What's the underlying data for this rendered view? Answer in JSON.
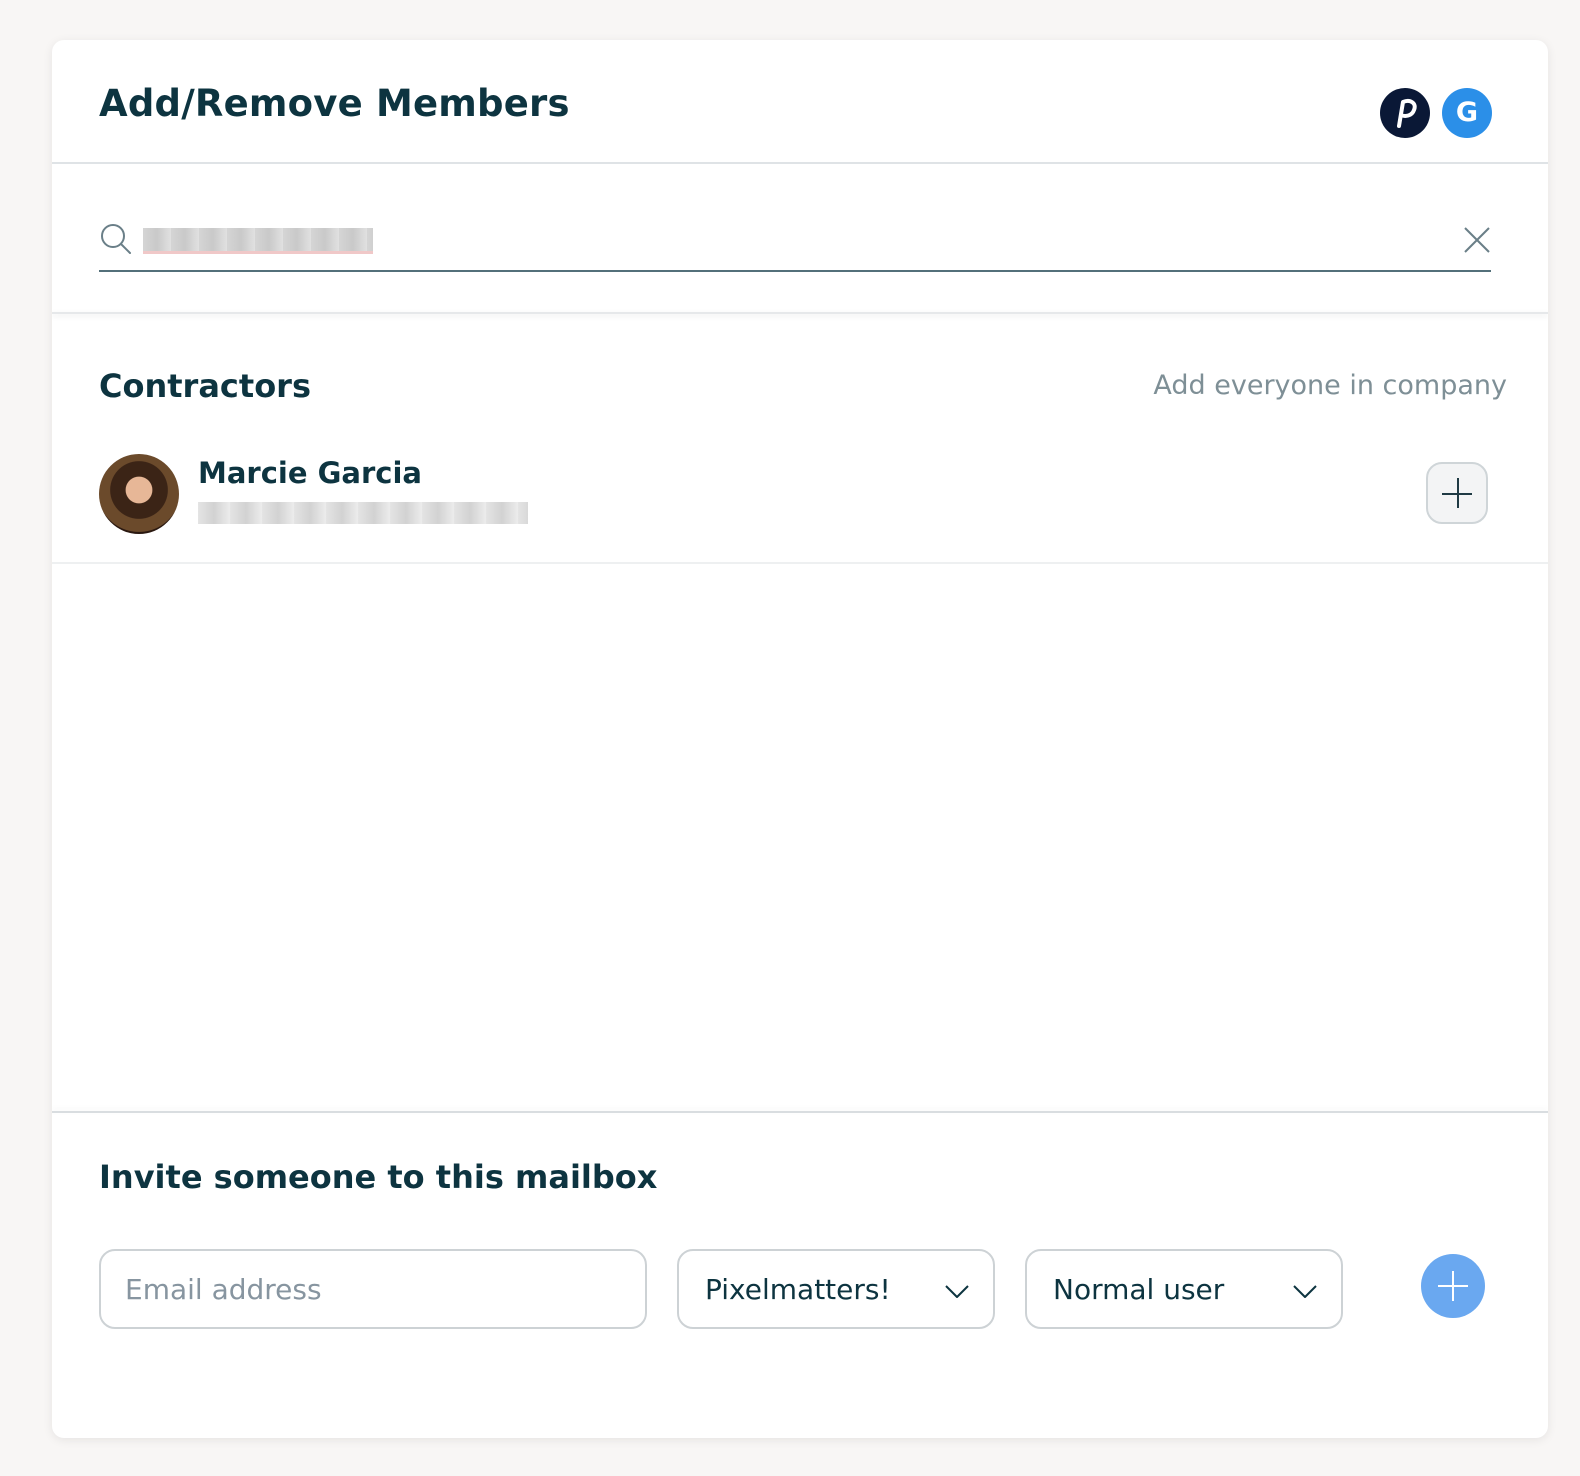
{
  "header": {
    "title": "Add/Remove Members",
    "avatars": [
      {
        "icon": "p-logo-icon",
        "color": "#0a1836"
      },
      {
        "label": "G",
        "color": "#2b8fe8"
      }
    ]
  },
  "search": {
    "value_redacted": true,
    "icon": "search-icon",
    "clear_icon": "close-icon"
  },
  "group": {
    "title": "Contractors",
    "add_all_label": "Add everyone in company",
    "members": [
      {
        "name": "Marcie Garcia",
        "email_redacted": true
      }
    ]
  },
  "invite": {
    "title": "Invite someone to this mailbox",
    "email_placeholder": "Email address",
    "company_value": "Pixelmatters!",
    "role_value": "Normal user",
    "add_color": "#6aa8f0"
  }
}
